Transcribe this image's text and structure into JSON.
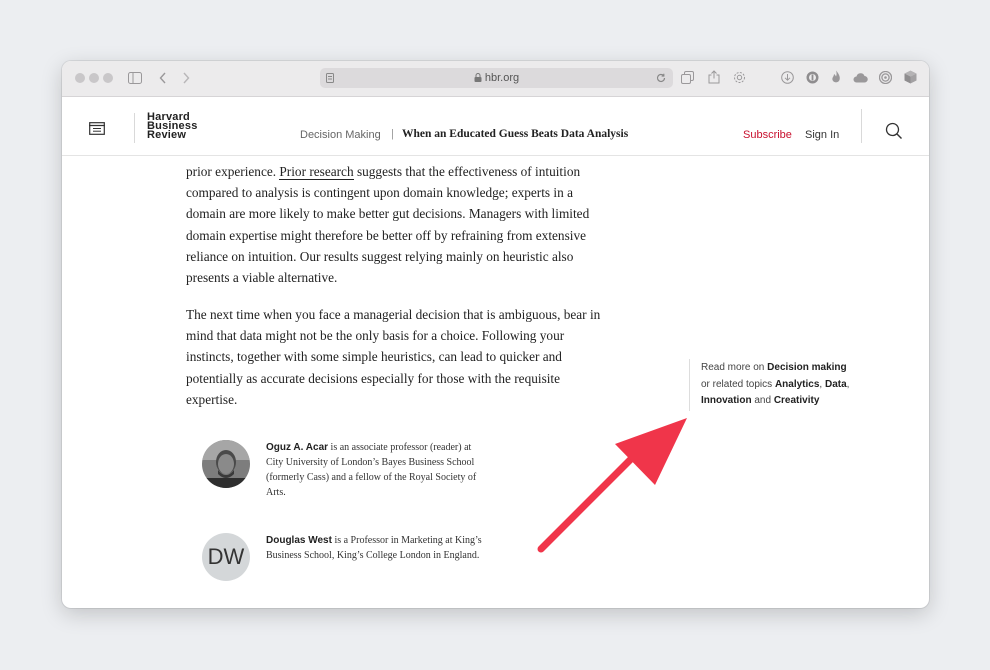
{
  "browser": {
    "url": "hbr.org",
    "icons": [
      "sidebar-toggle-icon",
      "back-icon",
      "forward-icon",
      "lock-icon",
      "reload-icon",
      "tab-overview-icon",
      "share-icon",
      "settings-icon",
      "download-icon",
      "extension-icon",
      "flame-icon",
      "cloud-icon",
      "spiral-icon",
      "cube-icon"
    ]
  },
  "header": {
    "logo_lines": [
      "Harvard",
      "Business",
      "Review"
    ],
    "section": "Decision Making",
    "separator": "|",
    "article_title": "When an Educated Guess Beats Data Analysis",
    "subscribe": "Subscribe",
    "signin": "Sign In",
    "accent_color": "#c8102e"
  },
  "article": {
    "para1_pre": "prior experience. ",
    "para1_link": "Prior research",
    "para1_post": " suggests that the effectiveness of intuition compared to analysis is contingent upon domain knowledge; experts in a domain are more likely to make better gut decisions. Managers with limited domain expertise might therefore be better off by refraining from extensive reliance on intuition. Our results suggest relying mainly on heuristic also presents a viable alternative.",
    "para2": "The next time when you face a managerial decision that is ambiguous, bear in mind that data might not be the only basis for a choice. Following your instincts, together with some simple heuristics, can lead to quicker and potentially as accurate decisions especially for those with the requisite expertise."
  },
  "sidebar": {
    "t1": "Read more on ",
    "topic_main": "Decision making",
    "t2": " or related topics ",
    "topic_a": "Analytics",
    "sep1": ", ",
    "topic_b": "Data",
    "sep2": ", ",
    "topic_c": "Innovation",
    "and": " and ",
    "topic_d": "Creativity"
  },
  "authors": [
    {
      "name": "Oguz A. Acar",
      "bio": " is an associate professor (reader) at City University of London’s Bayes Business School (formerly Cass) and a fellow of the Royal Society of Arts."
    },
    {
      "name": "Douglas West",
      "initials": "DW",
      "bio": " is a Professor in Marketing at King’s Business School, King’s College London in England."
    }
  ],
  "annotation": {
    "arrow_color": "#f0354a"
  }
}
